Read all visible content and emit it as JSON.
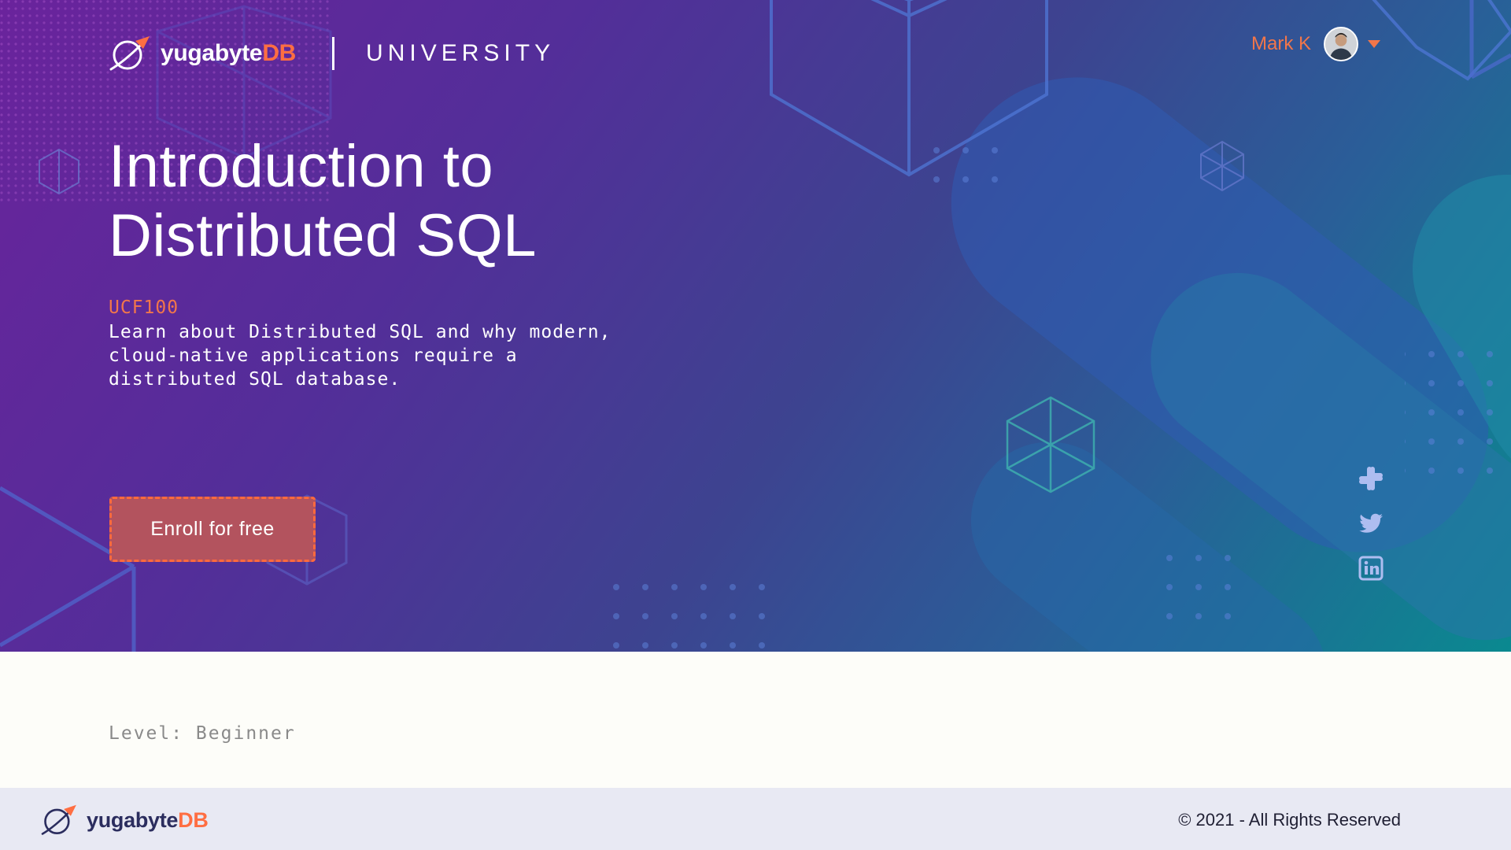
{
  "header": {
    "brand": {
      "name": "yugabyte",
      "name_suffix": "DB",
      "section": "UNIVERSITY"
    },
    "user": {
      "name": "Mark K"
    }
  },
  "hero": {
    "title_lines": [
      "Introduction to",
      "Distributed SQL"
    ],
    "course_code": "UCF100",
    "description_lines": [
      "Learn about Distributed SQL and why modern,",
      "cloud-native applications require a",
      "distributed SQL database."
    ],
    "enroll_label": "Enroll for free"
  },
  "details": {
    "level_text": "Level: Beginner"
  },
  "social": [
    "slack-icon",
    "twitter-icon",
    "linkedin-icon"
  ],
  "footer": {
    "brand": {
      "name": "yugabyte",
      "name_suffix": "DB"
    },
    "copyright": "© 2021 - All Rights Reserved"
  },
  "colors": {
    "accent": "#ff6e42",
    "user_name": "#f2764a",
    "button_fill": "#b3535e",
    "footer_bg": "#e8e9f3",
    "hero_gradient_start": "#6a239c",
    "hero_gradient_end": "#0a8990"
  }
}
